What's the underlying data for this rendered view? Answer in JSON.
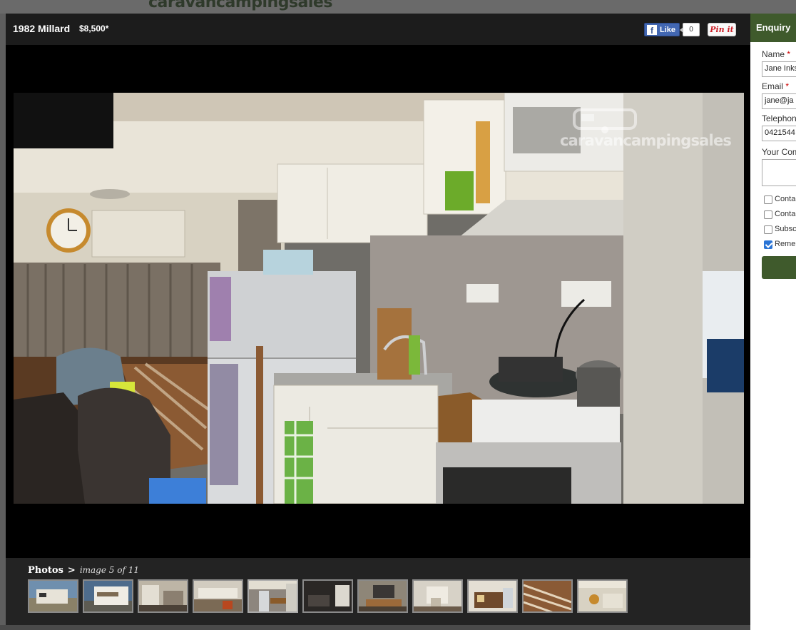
{
  "background": {
    "site_logo": "caravancampingsales"
  },
  "listing": {
    "title": "1982 Millard",
    "price": "$8,500*"
  },
  "social": {
    "fb_like_label": "Like",
    "fb_like_count": "0",
    "pinterest_label": "Pin it"
  },
  "photo": {
    "watermark": "caravancampingsales"
  },
  "gallery": {
    "photos_label": "Photos",
    "separator": ">",
    "counter": "image 5 of 11",
    "thumbnails": 11,
    "current_index": 5
  },
  "enquiry": {
    "heading": "Enquiry",
    "name_label": "Name",
    "name_value": "Jane Inkster",
    "email_label": "Email",
    "email_value": "jane@ja",
    "telephone_label": "Telephone",
    "telephone_value": "0421544",
    "comments_label": "Your Comments",
    "required_mark": "*",
    "checkboxes": [
      {
        "label": "Contact",
        "checked": false
      },
      {
        "label": "Contact",
        "checked": false
      },
      {
        "label": "Subscribe",
        "checked": false
      },
      {
        "label": "Remember",
        "checked": true
      }
    ]
  },
  "colors": {
    "brand_green": "#3f5a2c",
    "facebook_blue": "#4267b2",
    "pinterest_red": "#cb2027",
    "lightbox_bg": "#000000"
  }
}
